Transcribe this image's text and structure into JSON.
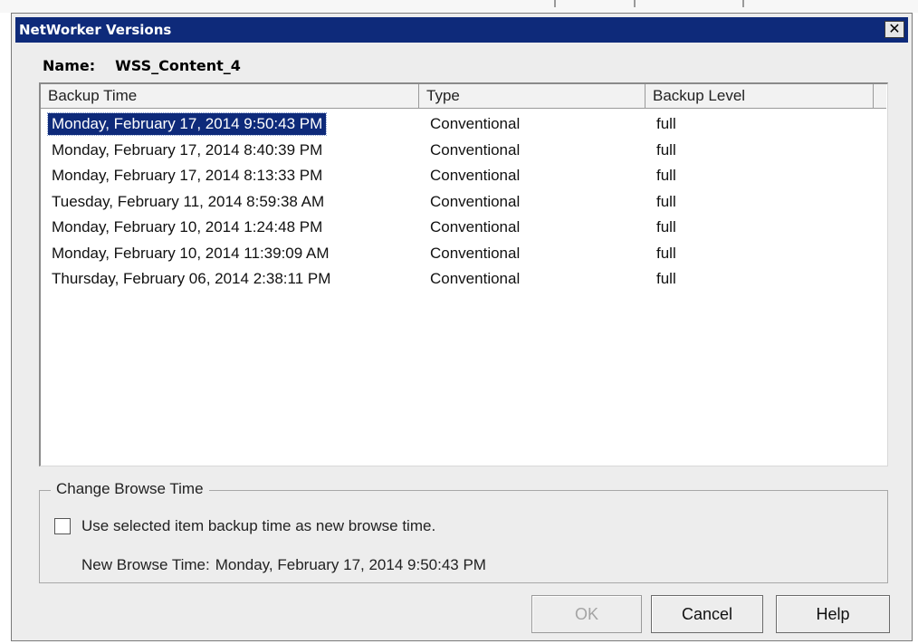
{
  "dialog": {
    "title": "NetWorker Versions",
    "close_glyph": "✕"
  },
  "name_row": {
    "label": "Name:",
    "value": "WSS_Content_4"
  },
  "table": {
    "columns": [
      "Backup Time",
      "Type",
      "Backup Level"
    ],
    "rows": [
      {
        "time": "Monday, February 17, 2014 9:50:43 PM",
        "type": "Conventional",
        "level": "full",
        "selected": true
      },
      {
        "time": "Monday, February 17, 2014 8:40:39 PM",
        "type": "Conventional",
        "level": "full"
      },
      {
        "time": "Monday, February 17, 2014 8:13:33 PM",
        "type": "Conventional",
        "level": "full"
      },
      {
        "time": "Tuesday, February 11, 2014 8:59:38 AM",
        "type": "Conventional",
        "level": "full"
      },
      {
        "time": "Monday, February 10, 2014 1:24:48 PM",
        "type": "Conventional",
        "level": "full"
      },
      {
        "time": "Monday, February 10, 2014 11:39:09 AM",
        "type": "Conventional",
        "level": "full"
      },
      {
        "time": "Thursday, February 06, 2014 2:38:11 PM",
        "type": "Conventional",
        "level": "full"
      }
    ]
  },
  "browse_group": {
    "label": "Change Browse Time",
    "checkbox_label": "Use selected item backup time as new browse time.",
    "checkbox_checked": false,
    "new_time_label": "New Browse Time:",
    "new_time_value": "Monday, February 17, 2014 9:50:43 PM"
  },
  "buttons": {
    "ok": "OK",
    "cancel": "Cancel",
    "help": "Help"
  },
  "colors": {
    "titlebar": "#0e2a7a",
    "selection": "#0e2a7a",
    "dialog_bg": "#ededed"
  }
}
